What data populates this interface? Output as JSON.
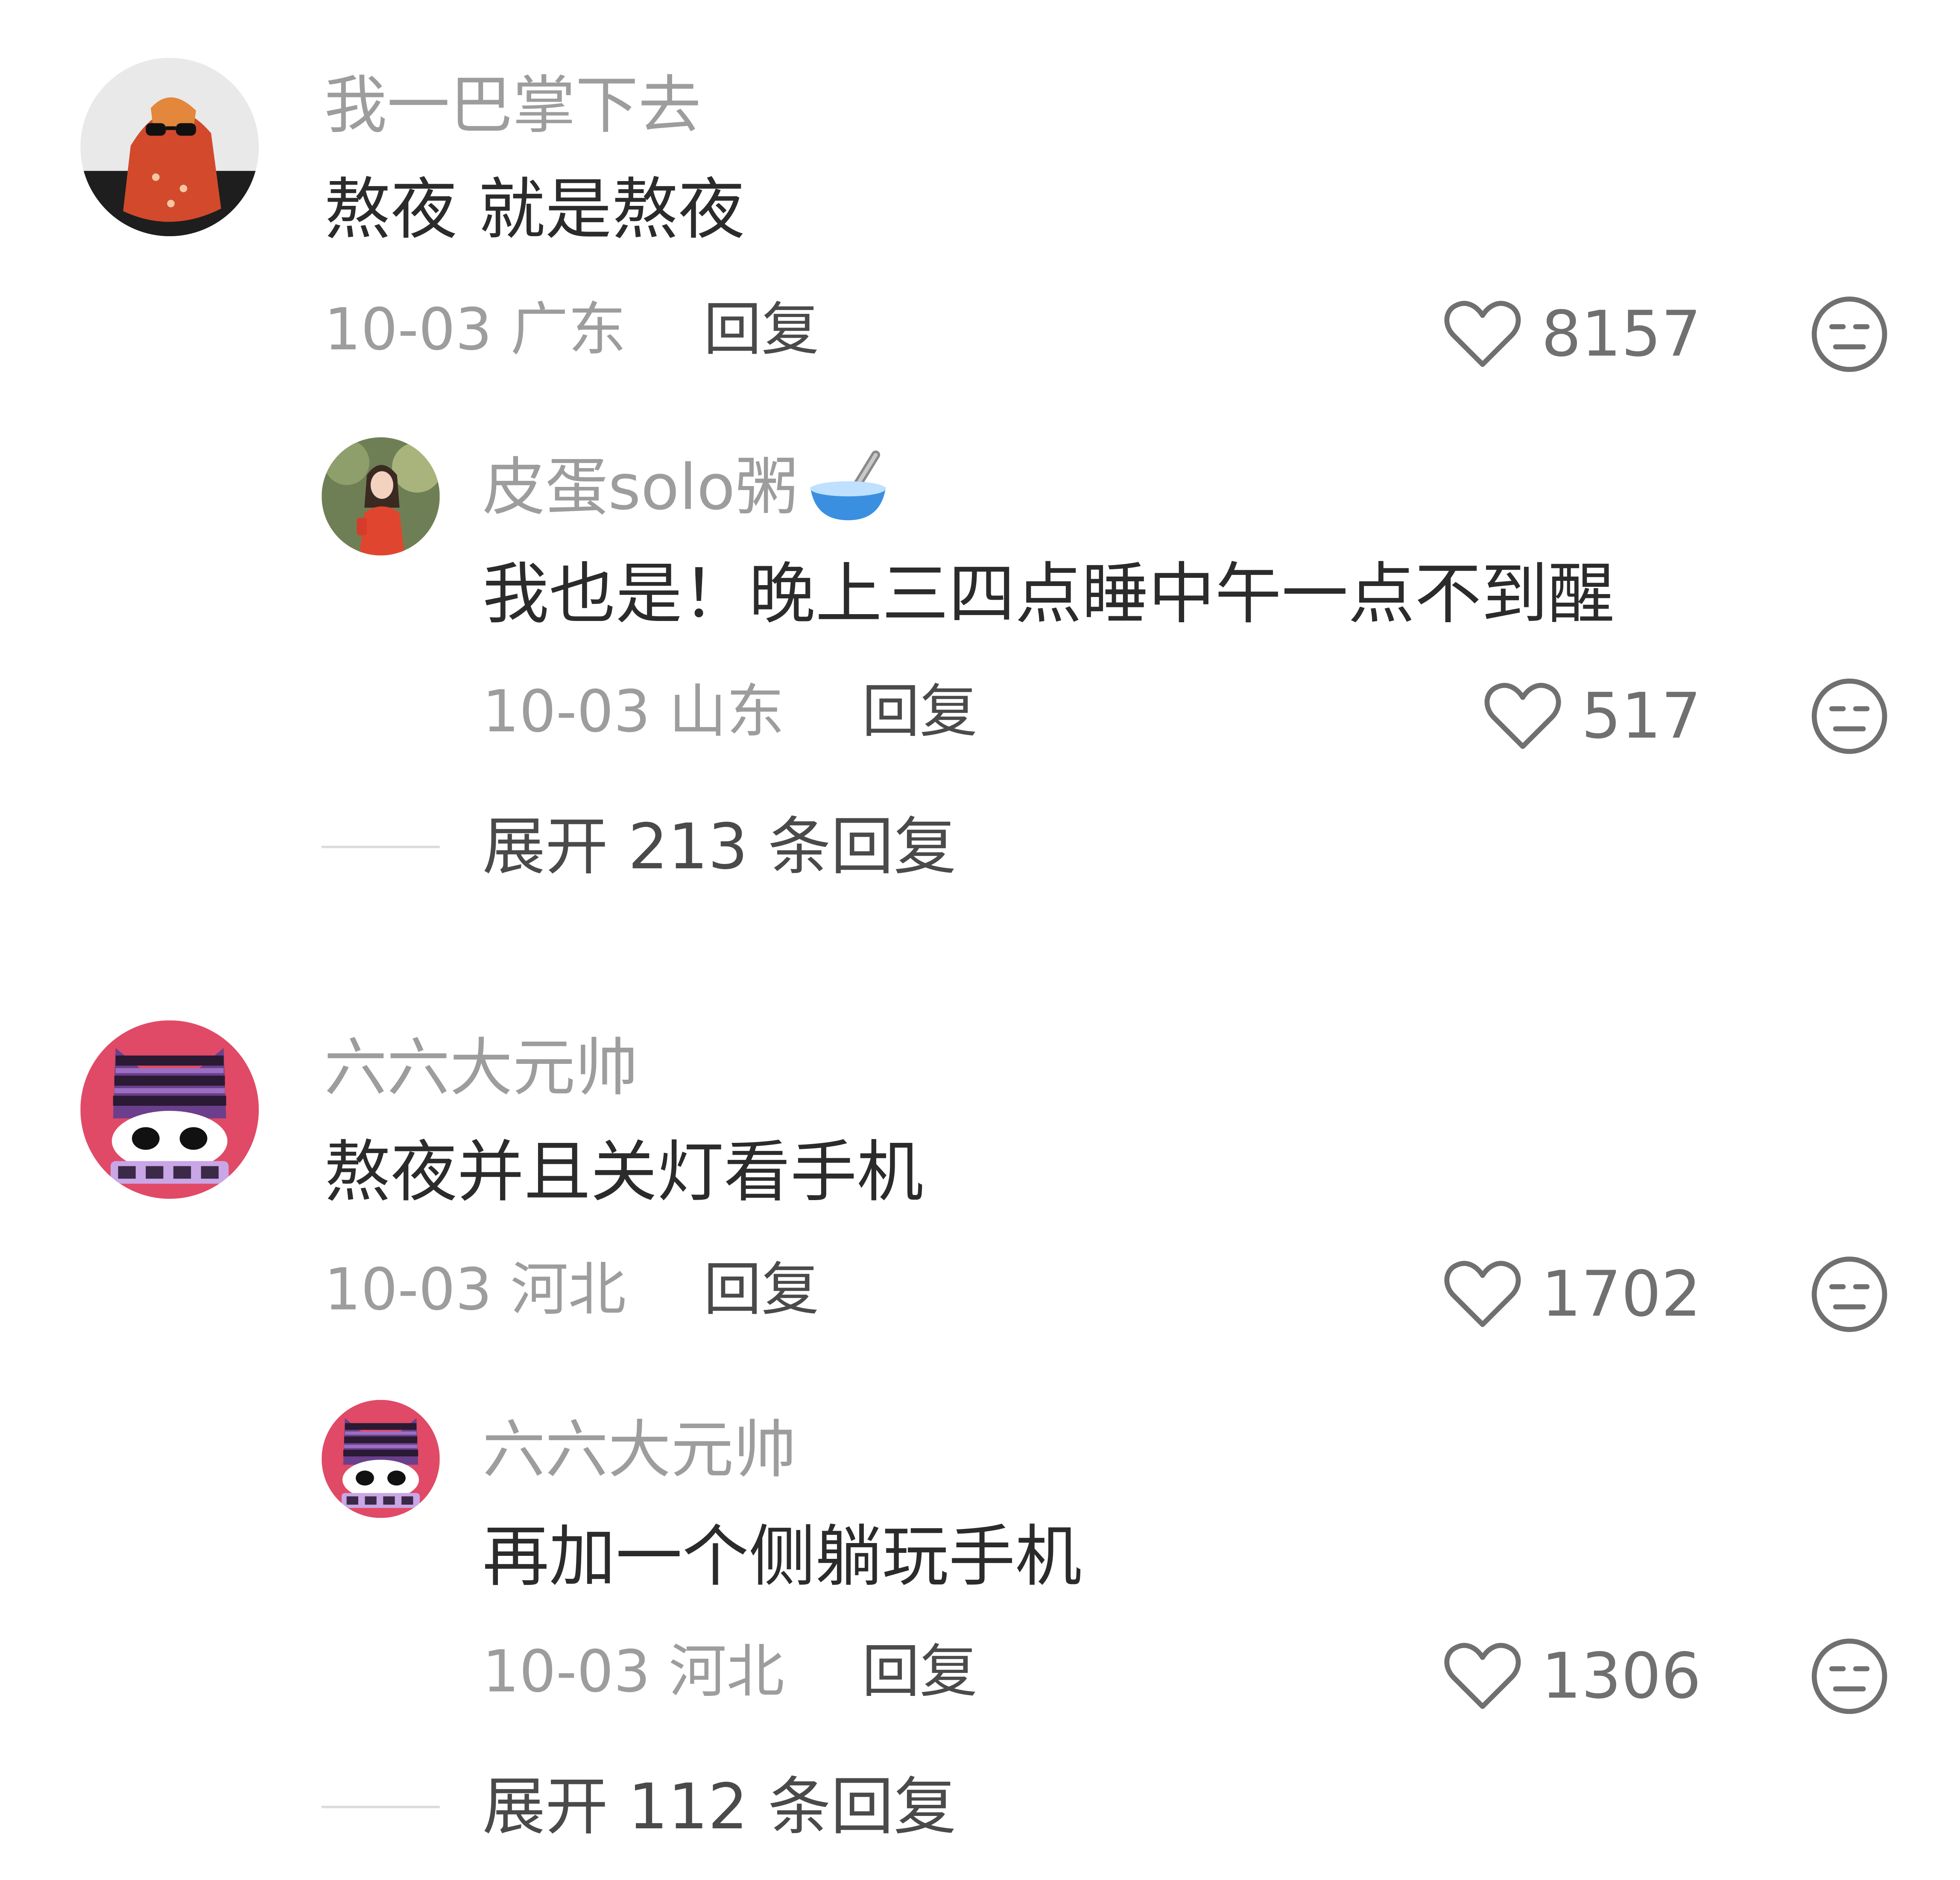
{
  "threads": [
    {
      "comment": {
        "username": "我一巴掌下去",
        "text": "熬夜 就是熬夜",
        "date_location": "10-03 广东",
        "reply_label": "回复",
        "likes": "8157",
        "avatar_icon": "cat-with-sunglasses-avatar"
      },
      "reply": {
        "username": "皮蛋solo粥",
        "username_emoji": "bowl-icon",
        "text": "我也是！晚上三四点睡中午一点不到醒",
        "date_location": "10-03 山东",
        "reply_label": "回复",
        "likes": "517",
        "avatar_icon": "girl-photo-avatar"
      },
      "expand_label": "展开 213 条回复"
    },
    {
      "comment": {
        "username": "六六大元帅",
        "text": "熬夜并且关灯看手机",
        "date_location": "10-03 河北",
        "reply_label": "回复",
        "likes": "1702",
        "avatar_icon": "striped-cat-cartoon-avatar"
      },
      "reply": {
        "username": "六六大元帅",
        "text": "再加一个侧躺玩手机",
        "date_location": "10-03 河北",
        "reply_label": "回复",
        "likes": "1306",
        "avatar_icon": "striped-cat-cartoon-avatar"
      },
      "expand_label": "展开 112 条回复"
    }
  ],
  "colors": {
    "username": "#9d9d9d",
    "text": "#2b2b2b",
    "meta": "#9d9d9d",
    "reply": "#4a4a4a",
    "icon": "#707070",
    "background": "#ffffff"
  }
}
